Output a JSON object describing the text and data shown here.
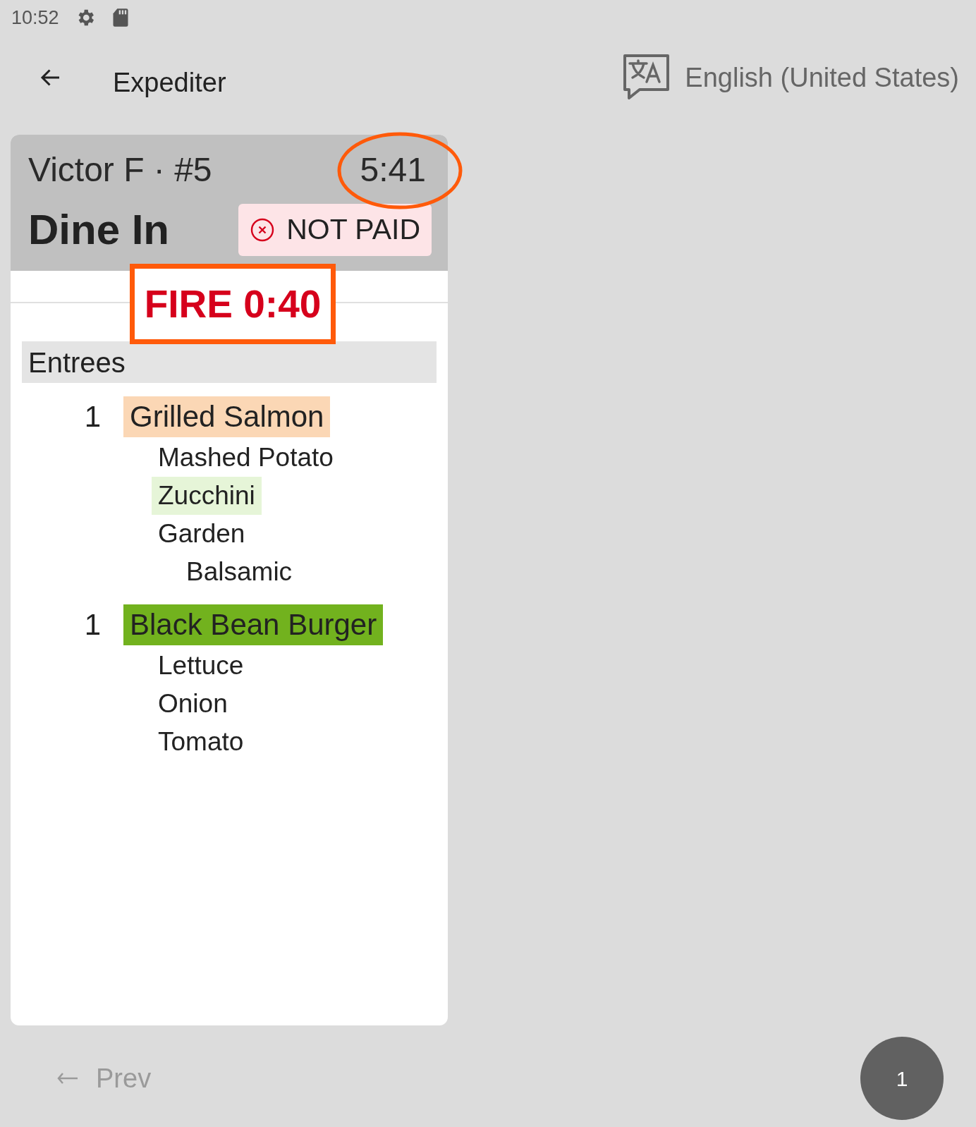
{
  "status_bar": {
    "time": "10:52"
  },
  "app_bar": {
    "title": "Expediter",
    "language": "English (United States)"
  },
  "ticket": {
    "heading": "Victor F · #5",
    "elapsed": "5:41",
    "elapsed_circled": true,
    "order_type": "Dine In",
    "payment": {
      "label": "NOT PAID",
      "paid": false
    },
    "fire": {
      "label": "FIRE 0:40",
      "boxed": true
    },
    "sections": [
      {
        "name": "Entrees",
        "items": [
          {
            "quantity": "1",
            "name": "Grilled Salmon",
            "color": "#fbd7b5",
            "modifiers": [
              {
                "name": "Mashed Potato"
              },
              {
                "name": "Zucchini",
                "color": "#e6f5d8"
              },
              {
                "name": "Garden",
                "children": [
                  {
                    "name": "Balsamic"
                  }
                ]
              }
            ]
          },
          {
            "quantity": "1",
            "name": "Black Bean Burger",
            "color": "#72b21e",
            "modifiers": [
              {
                "name": "Lettuce"
              },
              {
                "name": "Onion"
              },
              {
                "name": "Tomato"
              }
            ]
          }
        ]
      }
    ]
  },
  "pager": {
    "prev": {
      "label": "Prev",
      "disabled": true
    },
    "page": "1"
  }
}
